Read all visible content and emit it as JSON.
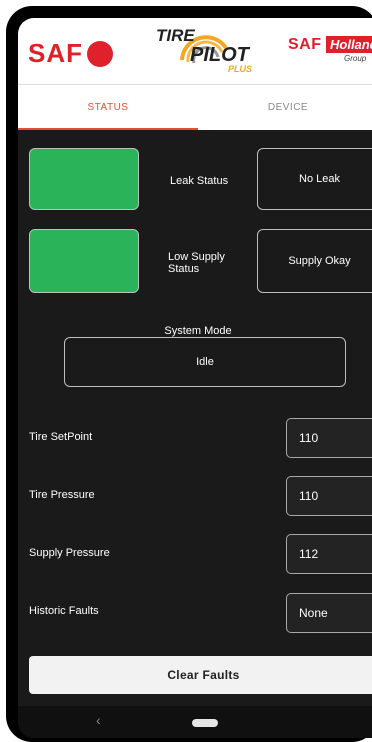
{
  "header": {
    "saf_logo_text": "SAF",
    "tirepilot_logo": {
      "tire": "TIRE",
      "pilot": "PILOT",
      "plus": "PLUS"
    },
    "saf_holland_logo": {
      "saf": "SAF",
      "holland": "Holland",
      "group": "Group"
    }
  },
  "tabs": [
    {
      "label": "STATUS",
      "active": true
    },
    {
      "label": "DEVICE",
      "active": false
    }
  ],
  "status": {
    "leak": {
      "label": "Leak Status",
      "value": "No Leak",
      "indicator_color": "#2bb35a"
    },
    "low_supply": {
      "label_line1": "Low Supply",
      "label_line2": "Status",
      "value": "Supply Okay",
      "indicator_color": "#2bb35a"
    },
    "system_mode": {
      "label": "System Mode",
      "value": "Idle"
    }
  },
  "readings": [
    {
      "label": "Tire SetPoint",
      "value": "110"
    },
    {
      "label": "Tire Pressure",
      "value": "110"
    },
    {
      "label": "Supply Pressure",
      "value": "112"
    },
    {
      "label": "Historic Faults",
      "value": "None"
    }
  ],
  "actions": {
    "clear_faults": "Clear Faults"
  },
  "nav": {
    "back": "‹"
  },
  "colors": {
    "accent": "#e3502f",
    "brand_red": "#e0202a",
    "ok_green": "#2bb35a",
    "background": "#1a1a1a"
  }
}
